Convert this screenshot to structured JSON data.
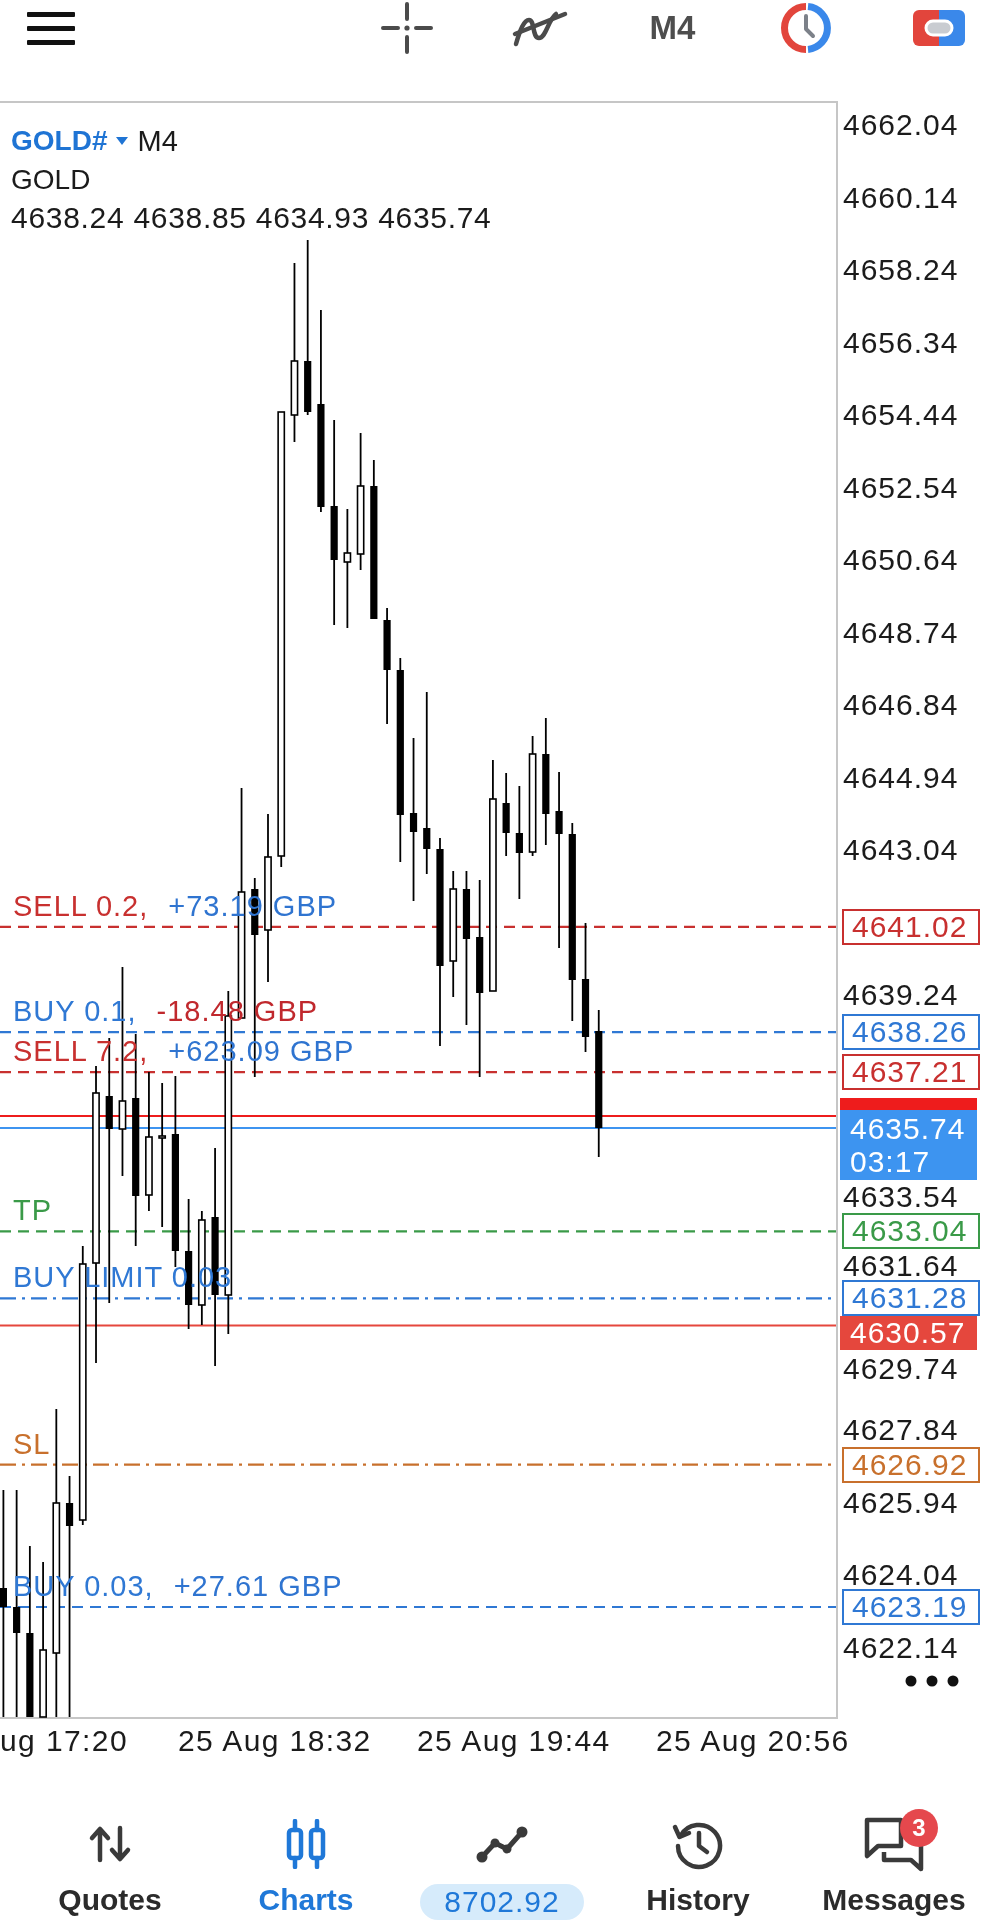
{
  "toolbar": {
    "timeframe": "M4"
  },
  "chart": {
    "symbol": "GOLD#",
    "timeframe": "M4",
    "description": "GOLD",
    "ohlc": "4638.24 4638.85 4634.93 4635.74",
    "lines": [
      {
        "kind": "position",
        "label": "SELL 0.2,",
        "profit": "+73.19 GBP",
        "in_profit": true,
        "price": "4641.02",
        "color": "#c8302f"
      },
      {
        "kind": "position",
        "label": "BUY 0.1,",
        "profit": "-18.48 GBP",
        "in_profit": false,
        "price": "4638.26",
        "color": "#2f78d4"
      },
      {
        "kind": "position",
        "label": "SELL 7.2,",
        "profit": "+623.09 GBP",
        "in_profit": true,
        "price": "4637.21",
        "color": "#c8302f"
      },
      {
        "kind": "ask",
        "color": "#ee1c1c"
      },
      {
        "kind": "bid",
        "price": "4635.74",
        "countdown": "03:17",
        "color": "#3d94f0"
      },
      {
        "kind": "take_profit",
        "label": "TP",
        "price": "4633.04",
        "color": "#3a9a48"
      },
      {
        "kind": "pending_order",
        "label": "BUY LIMIT 0.03",
        "price": "4631.28",
        "color": "#2f78d4"
      },
      {
        "kind": "level",
        "price": "4630.57",
        "color": "#e5473d"
      },
      {
        "kind": "stop_loss",
        "label": "SL",
        "price": "4626.92",
        "color": "#c8702c"
      },
      {
        "kind": "position",
        "label": "BUY 0.03,",
        "profit": "+27.61 GBP",
        "in_profit": true,
        "price": "4623.19",
        "color": "#2f78d4"
      }
    ],
    "price_labels": [
      "4662.04",
      "4660.14",
      "4658.24",
      "4656.34",
      "4654.44",
      "4652.54",
      "4650.64",
      "4648.74",
      "4646.84",
      "4644.94",
      "4643.04",
      "4639.24",
      "4633.54",
      "4631.64",
      "4629.74",
      "4627.84",
      "4625.94",
      "4624.04",
      "4622.14"
    ],
    "time_labels": [
      "ug 17:20",
      "25 Aug 18:32",
      "25 Aug 19:44",
      "25 Aug 20:56"
    ]
  },
  "nav": [
    {
      "kind": "quotes",
      "label": "Quotes",
      "selected": false
    },
    {
      "kind": "charts",
      "label": "Charts",
      "selected": true
    },
    {
      "kind": "trade",
      "label": "8702.92",
      "selected": false
    },
    {
      "kind": "history",
      "label": "History",
      "selected": false
    },
    {
      "kind": "messages",
      "label": "Messages",
      "selected": false,
      "badge": "3"
    }
  ]
}
